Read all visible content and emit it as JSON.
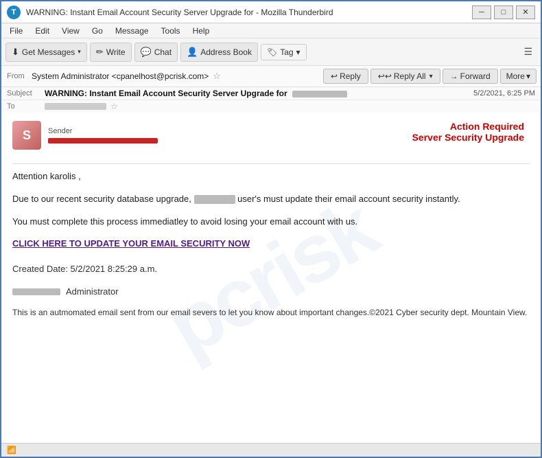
{
  "window": {
    "title": "WARNING: Instant Email Account Security Server Upgrade for  - Mozilla Thunderbird",
    "icon_label": "T"
  },
  "menu": {
    "items": [
      "File",
      "Edit",
      "View",
      "Go",
      "Message",
      "Tools",
      "Help"
    ]
  },
  "toolbar": {
    "get_messages": "Get Messages",
    "write": "Write",
    "chat": "Chat",
    "address_book": "Address Book",
    "tag": "Tag",
    "tag_arrow": "▾"
  },
  "email_actions": {
    "reply": "Reply",
    "reply_all": "Reply All",
    "forward": "Forward",
    "more": "More",
    "more_arrow": "▾",
    "reply_arrow": "▾"
  },
  "email_meta": {
    "from_label": "From",
    "from_name": "System Administrator <cpanelhost@pcrisk.com>",
    "subject_label": "Subject",
    "subject_text": "WARNING: Instant Email Account Security Server Upgrade for",
    "date": "5/2/2021, 6:25 PM",
    "to_label": "To"
  },
  "email_body": {
    "sender_label": "Sender",
    "action_required": "Action Required",
    "server_upgrade": "Server Security Upgrade",
    "greeting": "Attention  karolis ,",
    "paragraph1_start": "Due to our recent security database upgrade,",
    "paragraph1_blurred": "████████",
    "paragraph1_end": "user's must update their email account security instantly.",
    "paragraph2": "You must complete this process immediatley to avoid losing your email account with us.",
    "link_text": "CLICK HERE TO UPDATE YOUR EMAIL SECURITY NOW",
    "created_date": "Created Date:  5/2/2021 8:25:29 a.m.",
    "admin_text": "Administrator",
    "footer": "This is an autmomated email sent from our email severs to let you know about important changes.©2021 Cyber security dept. Mountain View."
  },
  "status_bar": {
    "icon": "📶"
  }
}
